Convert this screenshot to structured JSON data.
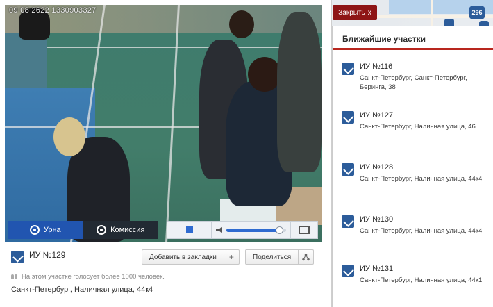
{
  "video": {
    "camera_id": "09 08 2622 1330903327"
  },
  "controls": {
    "urna_label": "Урна",
    "komissiya_label": "Комиссия",
    "volume_percent": 90
  },
  "station": {
    "title": "ИУ №129",
    "bookmark_label": "Добавить в закладки",
    "bookmark_icon": "+",
    "share_label": "Поделиться",
    "voters_note": "На этом участке голосует более 1000 человек.",
    "address": "Санкт-Петербург, Наличная улица, 44к4"
  },
  "map": {
    "close_label": "Закрыть",
    "close_icon": "x",
    "badge_count": "296"
  },
  "sidebar": {
    "title": "Ближайшие участки",
    "items": [
      {
        "name": "ИУ №116",
        "address": "Санкт-Петербург, Санкт-Петербург, Беринга, 38"
      },
      {
        "name": "ИУ №127",
        "address": "Санкт-Петербург, Наличная улица, 46"
      },
      {
        "name": "ИУ №128",
        "address": "Санкт-Петербург, Наличная улица, 44к4"
      },
      {
        "name": "ИУ №130",
        "address": "Санкт-Петербург, Наличная улица, 44к4"
      },
      {
        "name": "ИУ №131",
        "address": "Санкт-Петербург, Наличная улица, 44к1"
      }
    ]
  }
}
